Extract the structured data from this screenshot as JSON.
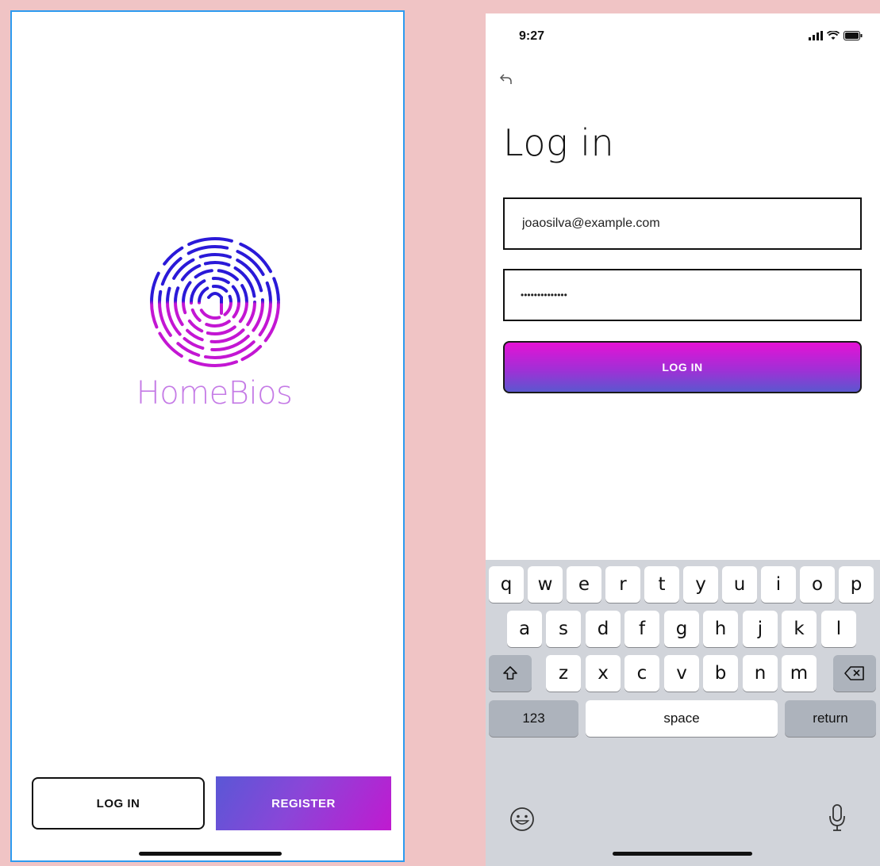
{
  "left_screen": {
    "brand_name": "HomeBios",
    "login_label": "LOG IN",
    "register_label": "REGISTER",
    "icons": {
      "logo": "fingerprint-icon"
    },
    "colors": {
      "frame": "#2d9bf0",
      "brand_text": "#c57be6",
      "fingerprint_top": "#2a19d8",
      "fingerprint_bottom": "#c316d3"
    }
  },
  "right_screen": {
    "status": {
      "time": "9:27",
      "icons": [
        "signal-icon",
        "wifi-icon",
        "battery-icon"
      ]
    },
    "back_icon": "back-arrow-icon",
    "title": "Log in",
    "email_value": "joaosilva@example.com",
    "password_value": "••••••••••••••",
    "login_label": "LOG IN",
    "colors": {
      "button_top": "#e512d5",
      "button_bottom": "#5b57cf"
    }
  },
  "keyboard": {
    "row1": [
      "q",
      "w",
      "e",
      "r",
      "t",
      "y",
      "u",
      "i",
      "o",
      "p"
    ],
    "row2": [
      "a",
      "s",
      "d",
      "f",
      "g",
      "h",
      "j",
      "k",
      "l"
    ],
    "row3": [
      "z",
      "x",
      "c",
      "v",
      "b",
      "n",
      "m"
    ],
    "shift_icon": "shift-icon",
    "delete_icon": "delete-icon",
    "numbers_label": "123",
    "space_label": "space",
    "return_label": "return",
    "emoji_icon": "emoji-icon",
    "mic_icon": "microphone-icon"
  }
}
